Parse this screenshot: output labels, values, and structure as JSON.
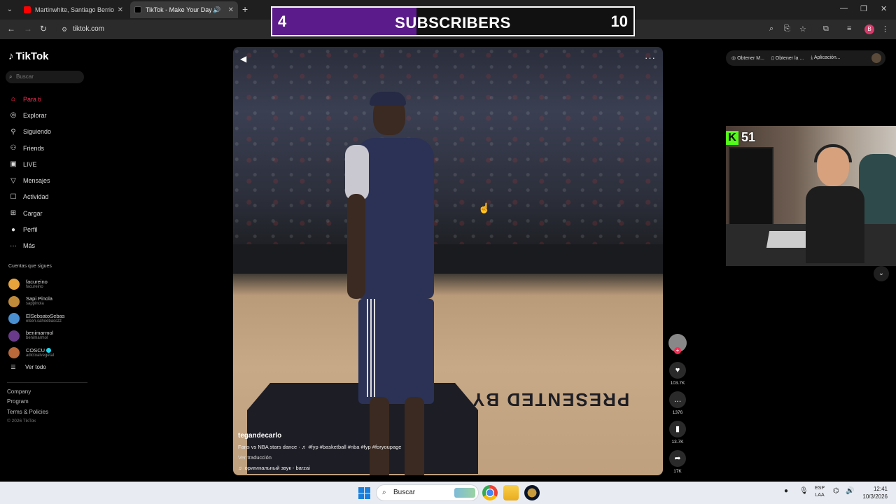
{
  "browser": {
    "tabs": [
      {
        "title": "Martinwhite, Santiago Berrio - A"
      },
      {
        "title": "TikTok - Make Your Day"
      }
    ],
    "url": "tiktok.com"
  },
  "overlay": {
    "left_count": "4",
    "label": "SUBSCRIBERS",
    "right_count": "10",
    "progress": 0.4,
    "kick_count": "51"
  },
  "sidebar": {
    "logo": "TikTok",
    "search_placeholder": "Buscar",
    "menu": [
      {
        "label": "Para ti",
        "icon": "home-icon"
      },
      {
        "label": "Explorar",
        "icon": "compass-icon"
      },
      {
        "label": "Siguiendo",
        "icon": "following-icon"
      },
      {
        "label": "Friends",
        "icon": "friends-icon"
      },
      {
        "label": "LIVE",
        "icon": "live-icon"
      },
      {
        "label": "Mensajes",
        "icon": "messages-icon"
      },
      {
        "label": "Actividad",
        "icon": "activity-icon"
      },
      {
        "label": "Cargar",
        "icon": "upload-icon"
      },
      {
        "label": "Perfil",
        "icon": "profile-icon"
      },
      {
        "label": "Más",
        "icon": "more-icon"
      }
    ],
    "following_title": "Cuentas que sigues",
    "following": [
      {
        "name": "facureino",
        "handle": "facureino",
        "color": "#e8a33d"
      },
      {
        "name": "Sapi Pinola",
        "handle": "sappinola",
        "color": "#c08a3a"
      },
      {
        "name": "ElSebsatoSebas",
        "handle": "elsen.sahoebasszz",
        "color": "#4a8fd0"
      },
      {
        "name": "benimarmol",
        "handle": "benimarmol",
        "color": "#6a3a8a"
      },
      {
        "name": "COSCU",
        "handle": "adictoalvegetal",
        "color": "#b8683a"
      }
    ],
    "see_all": "Ver todo",
    "footer": [
      "Company",
      "Program",
      "Terms & Policies"
    ],
    "copyright": "© 2026 TikTok"
  },
  "video": {
    "author": "tegandecarlo",
    "description": "Fans vs NBA stars dance · ♬ #fyp #basketball #nba #fyp #foryoupage",
    "translation": "Ver traducción",
    "sound": "оригинальный звук - barzai",
    "floor_text": "PRESENTED BY",
    "likes": "103.7K",
    "comments": "1376",
    "saves": "13.7K",
    "shares": "17K"
  },
  "right_actions": [
    "Obtener M...",
    "Obtener la ...",
    "Aplicación..."
  ],
  "taskbar": {
    "search": "Buscar",
    "lang_top": "ESP",
    "lang_bottom": "LAA",
    "time": "12:41",
    "date": "10/3/2026"
  }
}
